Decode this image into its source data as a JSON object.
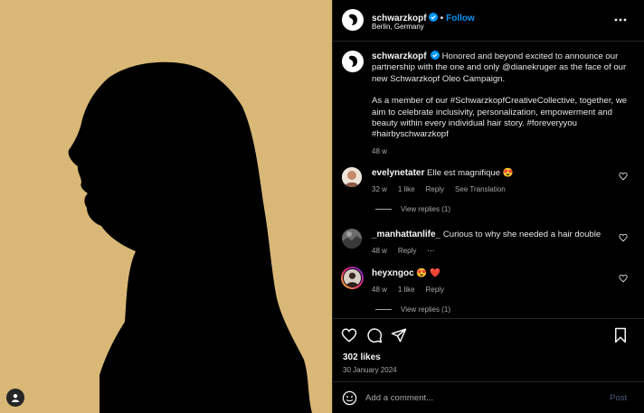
{
  "header": {
    "username": "schwarzkopf",
    "separator": "•",
    "follow_label": "Follow",
    "location": "Berlin, Germany"
  },
  "caption": {
    "username": "schwarzkopf",
    "text_1": "Honored and beyond excited to announce our partnership with the one and only @dianekruger as the face of our new Schwarzkopf Oleo Campaign.",
    "text_2": "As a member of our #SchwarzkopfCreativeCollective, together, we aim to celebrate inclusivity, personalization, empowerment and beauty within every individual hair story. #foreveryyou #hairbyschwarzkopf",
    "age": "48 w"
  },
  "comments": [
    {
      "username": "evelynetater",
      "text": "Elle est magnifique 😍",
      "age": "32 w",
      "likes": "1 like",
      "reply_label": "Reply",
      "translate_label": "See Translation",
      "view_replies": "View replies (1)"
    },
    {
      "username": "_manhattanlife_",
      "text": "Curious to why she needed a hair double",
      "age": "48 w",
      "reply_label": "Reply",
      "more": "···"
    },
    {
      "username": "heyxngoc",
      "text": "😍 ❤️",
      "age": "48 w",
      "likes": "1 like",
      "reply_label": "Reply",
      "view_replies": "View replies (1)"
    }
  ],
  "actions": {
    "likes": "302 likes",
    "date": "30 January 2024"
  },
  "composer": {
    "placeholder": "Add a comment...",
    "post_label": "Post"
  },
  "colors": {
    "background": "#000000",
    "media_bg": "#d9b877",
    "accent": "#0095f6",
    "verified": "#0095f6",
    "heart_red": "#ff3040"
  },
  "icons": [
    "user-tag-icon",
    "verified-badge-icon",
    "more-options-icon",
    "heart-icon",
    "comment-icon",
    "share-icon",
    "bookmark-icon",
    "emoji-icon"
  ]
}
